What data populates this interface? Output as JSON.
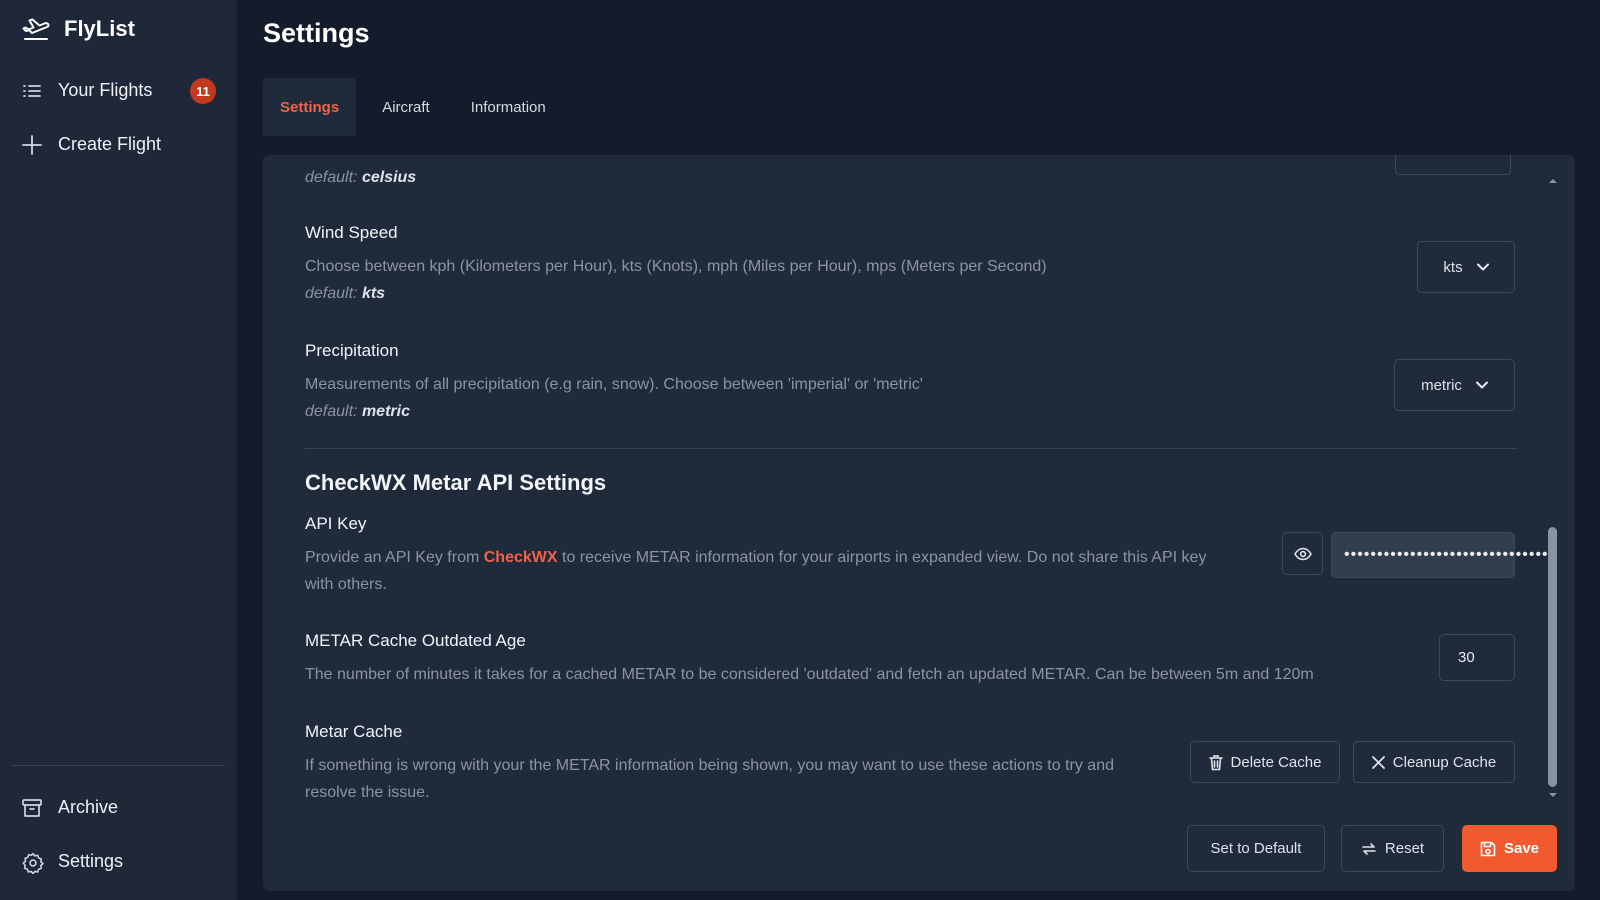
{
  "app": {
    "name": "FlyList"
  },
  "sidebar": {
    "items": [
      {
        "label": "Your Flights",
        "icon": "list-icon",
        "badge": "11"
      },
      {
        "label": "Create Flight",
        "icon": "plus-icon"
      }
    ],
    "bottom_items": [
      {
        "label": "Archive",
        "icon": "archive-icon"
      },
      {
        "label": "Settings",
        "icon": "gear-icon"
      }
    ]
  },
  "page": {
    "title": "Settings"
  },
  "tabs": [
    {
      "label": "Settings",
      "active": true
    },
    {
      "label": "Aircraft",
      "active": false
    },
    {
      "label": "Information",
      "active": false
    }
  ],
  "settings": {
    "temperature": {
      "default_prefix": "default:",
      "default_value": "celsius"
    },
    "wind_speed": {
      "title": "Wind Speed",
      "description": "Choose between kph (Kilometers per Hour), kts (Knots), mph (Miles per Hour), mps (Meters per Second)",
      "default_prefix": "default:",
      "default_value": "kts",
      "selected": "kts"
    },
    "precipitation": {
      "title": "Precipitation",
      "description": "Measurements of all precipitation (e.g rain, snow). Choose between 'imperial' or 'metric'",
      "default_prefix": "default:",
      "default_value": "metric",
      "selected": "metric"
    }
  },
  "checkwx": {
    "section_title": "CheckWX Metar API Settings",
    "api_key": {
      "title": "API Key",
      "desc_before": "Provide an API Key from ",
      "link_text": "CheckWX",
      "desc_after": " to receive METAR information for your airports in expanded view. Do not share this API key",
      "desc_line2": "with others.",
      "value_masked": "••••••••••••••••••••••••••••••••"
    },
    "cache_age": {
      "title": "METAR Cache Outdated Age",
      "description": "The number of minutes it takes for a cached METAR to be considered 'outdated' and fetch an updated METAR. Can be between 5m and 120m",
      "value": "30"
    },
    "metar_cache": {
      "title": "Metar Cache",
      "description_line1": "If something is wrong with your the METAR information being shown, you may want to use these actions to try and",
      "description_line2": "resolve the issue.",
      "delete_label": "Delete Cache",
      "cleanup_label": "Cleanup Cache"
    }
  },
  "footer": {
    "set_default_label": "Set to Default",
    "reset_label": "Reset",
    "save_label": "Save"
  },
  "colors": {
    "accent": "#f0624a",
    "primary_button": "#f05a2e",
    "badge": "#c2391f",
    "sidebar_bg": "#1e2838",
    "panel_bg": "#1f2a3b",
    "page_bg": "#141c2b"
  }
}
